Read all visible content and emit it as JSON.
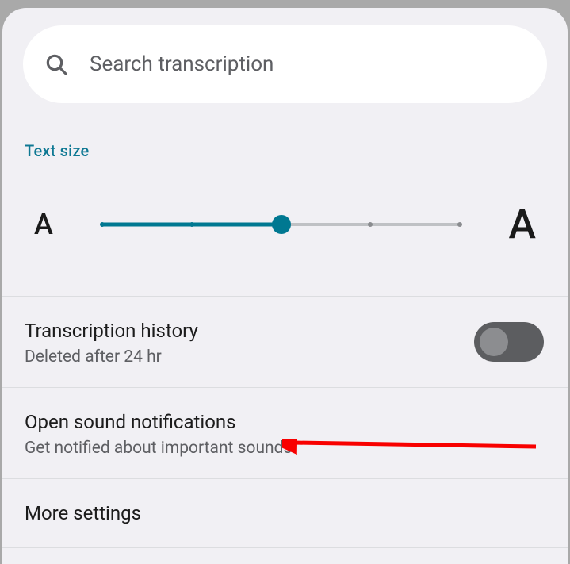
{
  "search": {
    "placeholder": "Search transcription"
  },
  "textSize": {
    "header": "Text size",
    "small_mark": "A",
    "large_mark": "A"
  },
  "items": {
    "history": {
      "title": "Transcription history",
      "subtitle": "Deleted after 24 hr"
    },
    "sound": {
      "title": "Open sound notifications",
      "subtitle": "Get notified about important sounds"
    },
    "more": {
      "title": "More settings"
    }
  }
}
